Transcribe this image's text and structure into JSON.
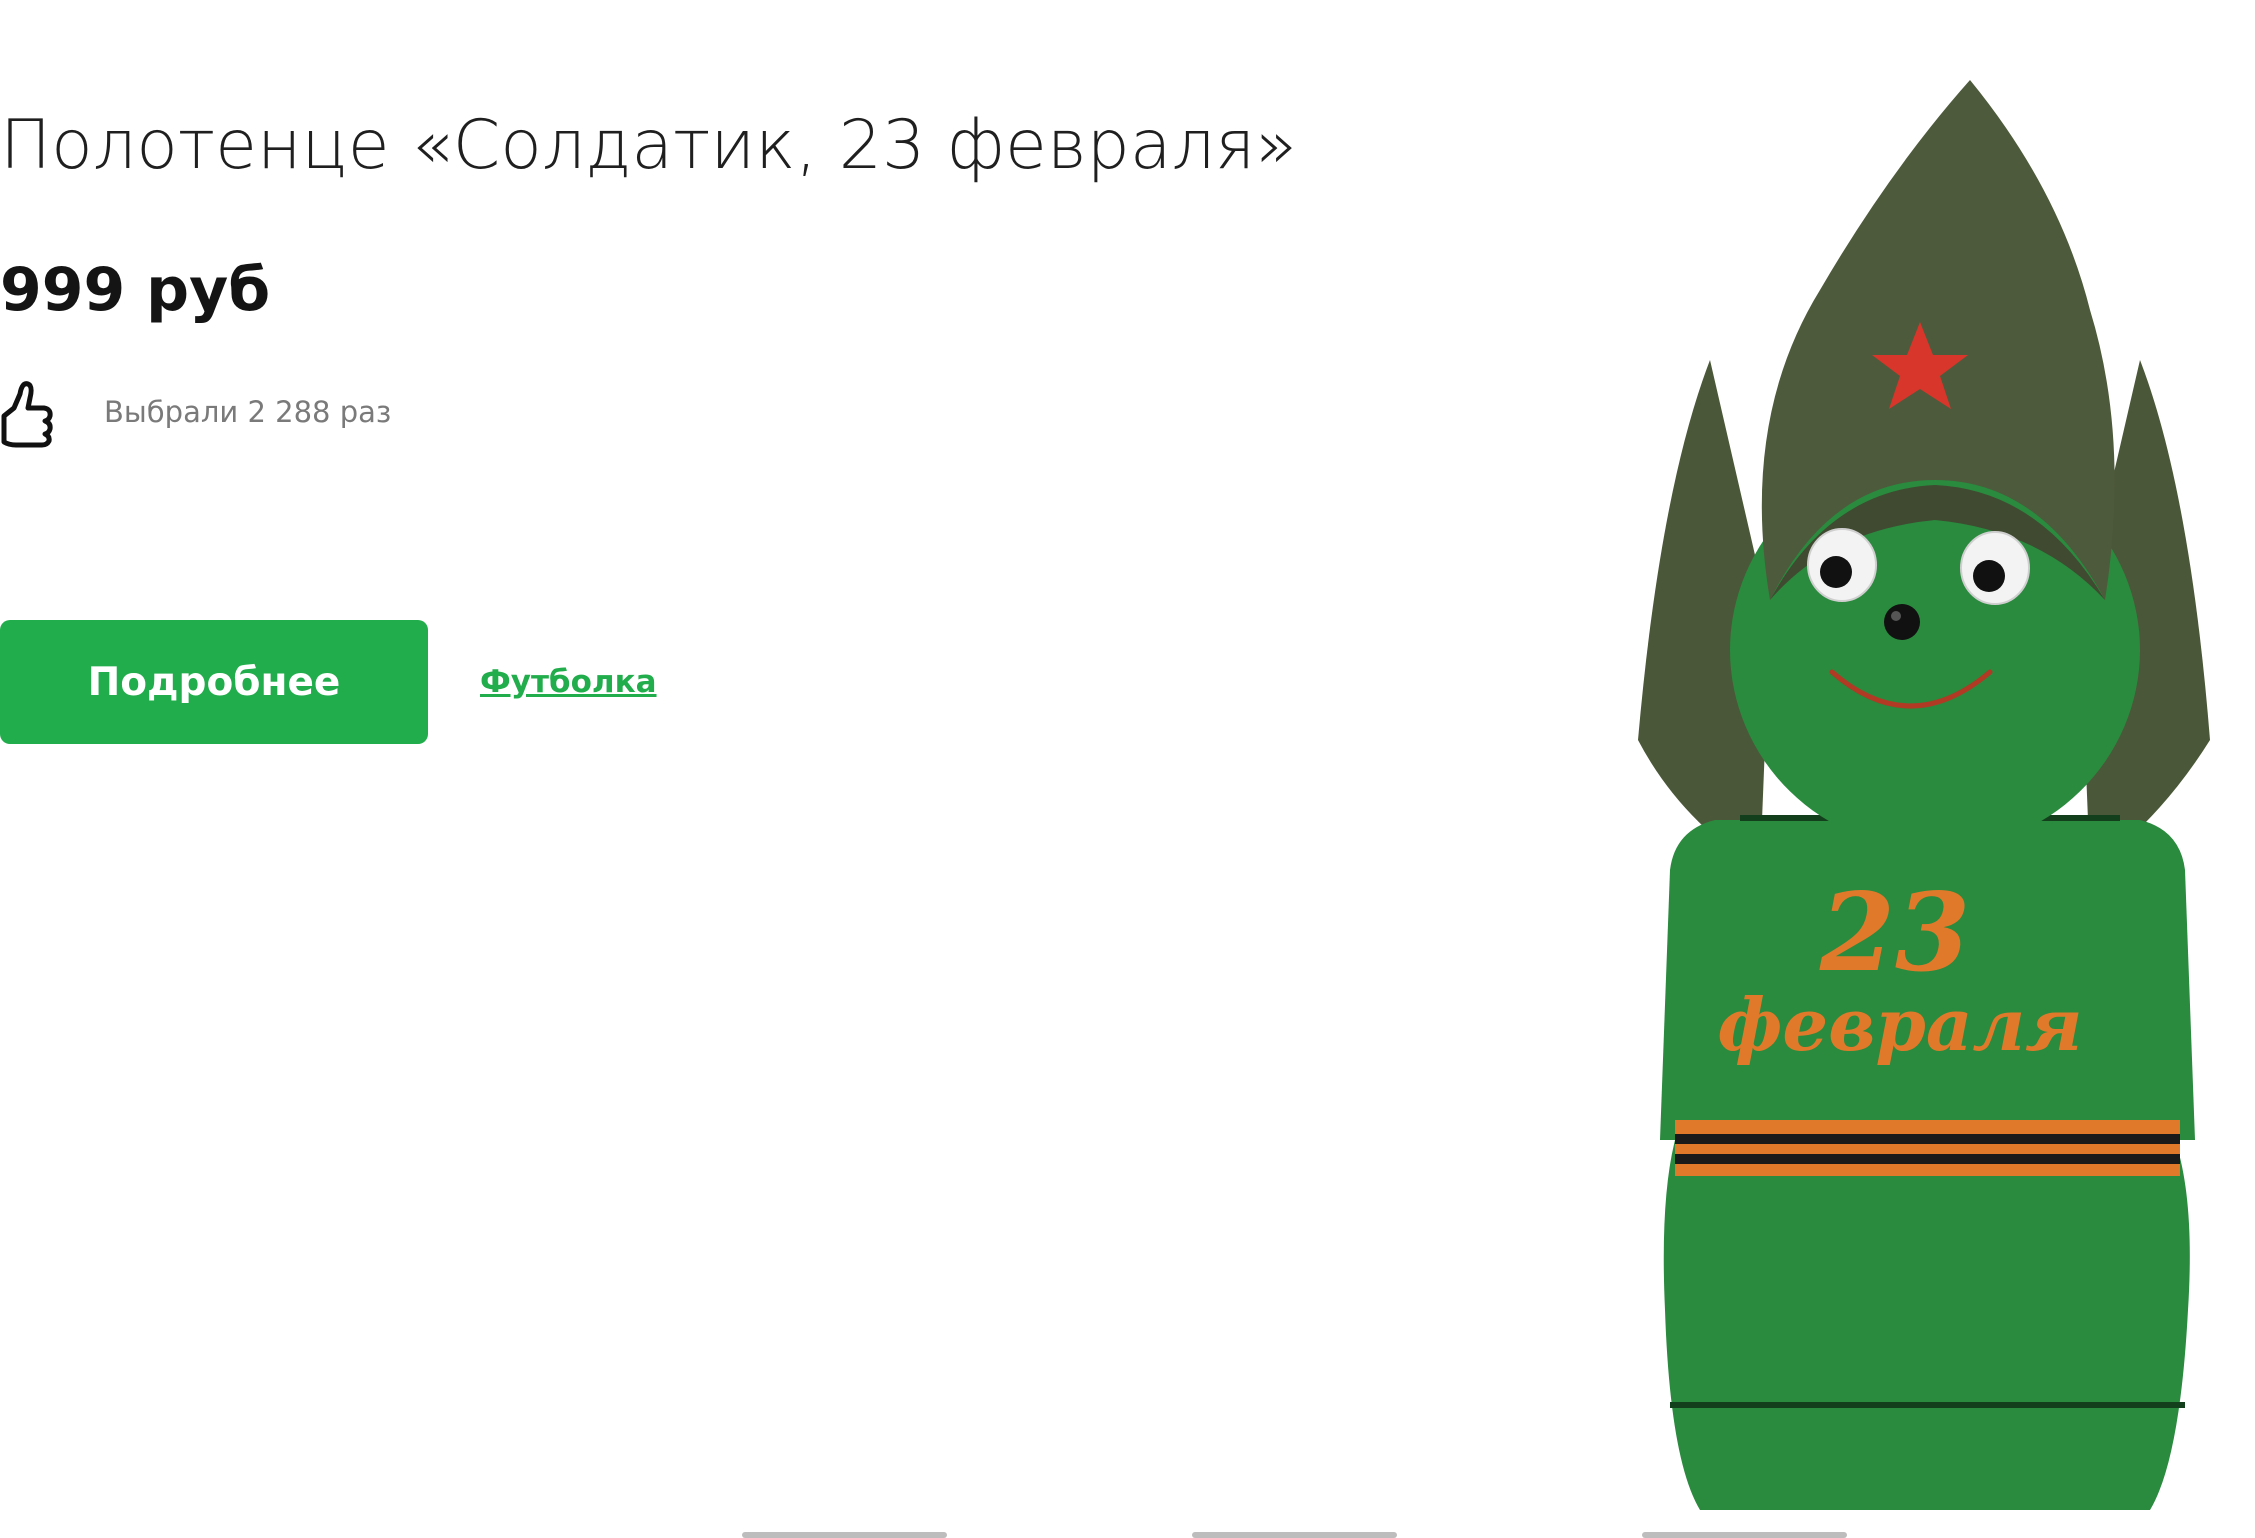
{
  "product": {
    "title": "Полотенце «Солдатик, 23 февраля»",
    "price": "999 руб",
    "likes_text": "Выбрали 2 288 раз",
    "details_button_label": "Подробнее",
    "category_link_label": "Футболка",
    "image_text": {
      "line1": "23",
      "line2": "февраля"
    }
  },
  "pager": {
    "page_count": 3
  },
  "colors": {
    "accent": "#21ad4b",
    "towel_green": "#2a8a3e",
    "hat_olive": "#4d5a3b",
    "embroidery": "#e07a2a"
  },
  "icons": {
    "likes": "thumbs-up-icon"
  }
}
